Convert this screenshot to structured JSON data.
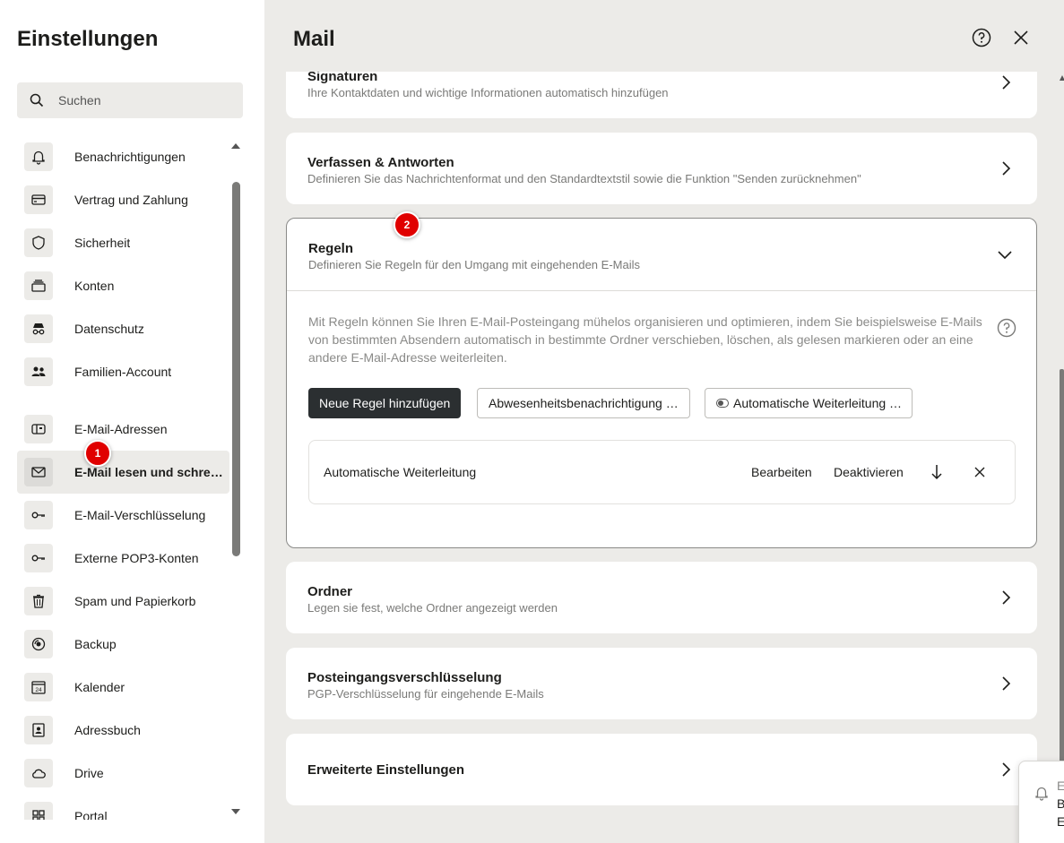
{
  "sidebar": {
    "title": "Einstellungen",
    "search_placeholder": "Suchen",
    "items": [
      {
        "label": "Benachrichtigungen",
        "icon": "bell-icon"
      },
      {
        "label": "Vertrag und Zahlung",
        "icon": "credit-card-icon"
      },
      {
        "label": "Sicherheit",
        "icon": "shield-icon"
      },
      {
        "label": "Konten",
        "icon": "accounts-stack-icon"
      },
      {
        "label": "Datenschutz",
        "icon": "incognito-icon"
      },
      {
        "label": "Familien-Account",
        "icon": "family-icon"
      },
      {
        "label": "E-Mail-Adressen",
        "icon": "mailbox-icon"
      },
      {
        "label": "E-Mail lesen und schreiben",
        "icon": "envelope-icon"
      },
      {
        "label": "E-Mail-Verschlüsselung",
        "icon": "key-icon"
      },
      {
        "label": "Externe POP3-Konten",
        "icon": "key-icon"
      },
      {
        "label": "Spam und Papierkorb",
        "icon": "trash-icon"
      },
      {
        "label": "Backup",
        "icon": "backup-icon"
      },
      {
        "label": "Kalender",
        "icon": "calendar-icon",
        "icon_text": "24"
      },
      {
        "label": "Adressbuch",
        "icon": "contact-book-icon"
      },
      {
        "label": "Drive",
        "icon": "cloud-icon"
      },
      {
        "label": "Portal",
        "icon": "grid-icon"
      }
    ]
  },
  "header": {
    "title": "Mail"
  },
  "sections": {
    "signaturen": {
      "title": "Signaturen",
      "subtitle": "Ihre Kontaktdaten und wichtige Informationen automatisch hinzufügen"
    },
    "verfassen": {
      "title": "Verfassen & Antworten",
      "subtitle": "Definieren Sie das Nachrichtenformat und den Standardtextstil sowie die Funktion \"Senden zurücknehmen\""
    },
    "regeln": {
      "title": "Regeln",
      "subtitle": "Definieren Sie Regeln für den Umgang mit eingehenden E-Mails",
      "description": "Mit Regeln können Sie Ihren E-Mail-Posteingang mühelos organisieren und optimieren, indem Sie beispielsweise E-Mails von bestimmten Absendern automatisch in bestimmte Ordner verschieben, löschen, als gelesen markieren oder an eine andere E-Mail-Adresse weiterleiten.",
      "buttons": {
        "new_rule": "Neue Regel hinzufügen",
        "absence": "Abwesenheitsbenachrichtigung …",
        "forward": "Automatische Weiterleitung …"
      },
      "rule": {
        "name": "Automatische Weiterleitung",
        "edit": "Bearbeiten",
        "deactivate": "Deaktivieren"
      }
    },
    "ordner": {
      "title": "Ordner",
      "subtitle": "Legen sie fest, welche Ordner angezeigt werden"
    },
    "posteingang": {
      "title": "Posteingangsverschlüsselung",
      "subtitle": "PGP-Verschlüsselung für eingehende E-Mails"
    },
    "erweitert": {
      "title": "Erweiterte Einstellungen"
    }
  },
  "badges": {
    "one": "1",
    "two": "2"
  },
  "toast": {
    "line1": "E",
    "line2": "B",
    "line3": "E"
  },
  "colors": {
    "accent_dark": "#2b2f31",
    "badge_red": "#e00000",
    "muted_text": "#7a7a78"
  }
}
